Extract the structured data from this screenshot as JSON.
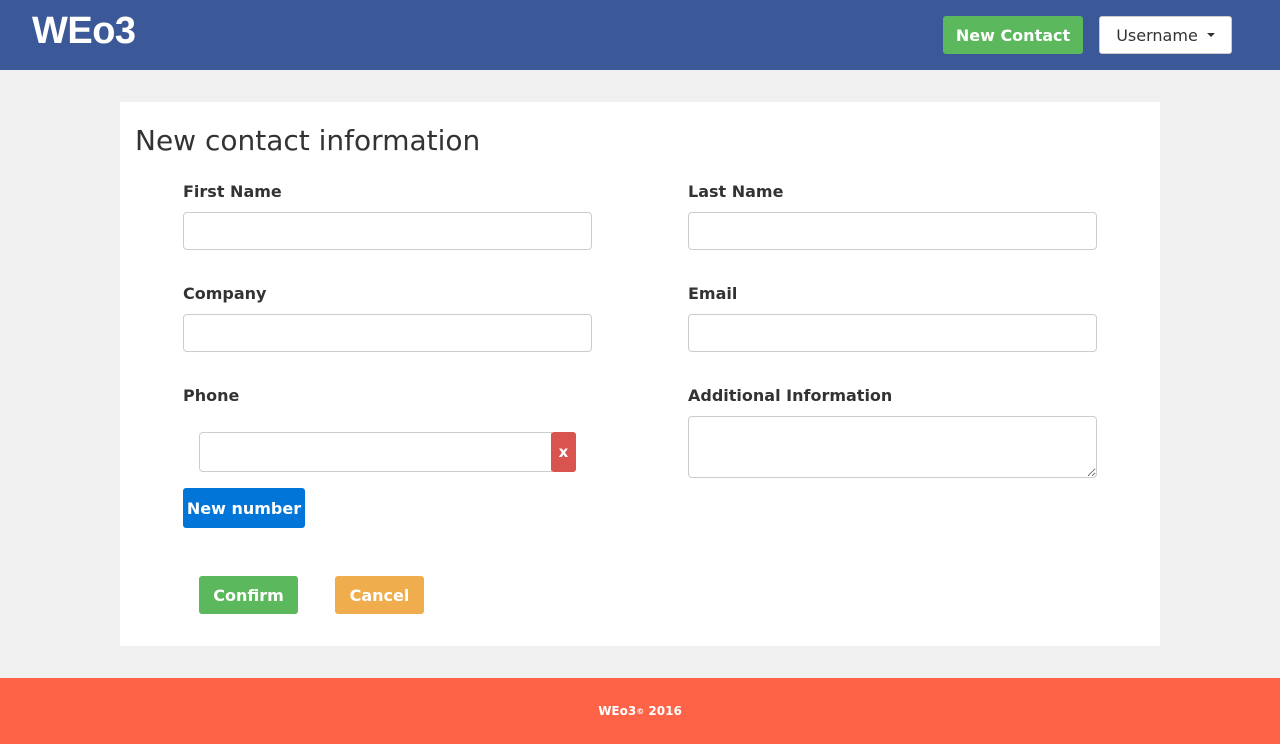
{
  "colors": {
    "navbar": "#3b5998",
    "success": "#5cb85c",
    "danger": "#d9534f",
    "primary": "#0275d8",
    "warning": "#f0ad4e",
    "footer": "#ff6347",
    "page_bg": "#f0f0f0"
  },
  "navbar": {
    "brand": "WEo3",
    "new_contact_label": "New Contact",
    "user_menu_label": "Username",
    "user_menu_icon": "caret-down-icon"
  },
  "form": {
    "title": "New contact information",
    "first_name": {
      "label": "First Name",
      "value": ""
    },
    "last_name": {
      "label": "Last Name",
      "value": ""
    },
    "company": {
      "label": "Company",
      "value": ""
    },
    "email": {
      "label": "Email",
      "value": ""
    },
    "phone": {
      "label": "Phone",
      "value": "",
      "remove_label": "x"
    },
    "additional_info": {
      "label": "Additional Information",
      "value": ""
    },
    "new_number_label": "New number",
    "confirm_label": "Confirm",
    "cancel_label": "Cancel"
  },
  "footer": {
    "brand": "WEo3",
    "copyright_symbol": "©",
    "year": "2016"
  }
}
